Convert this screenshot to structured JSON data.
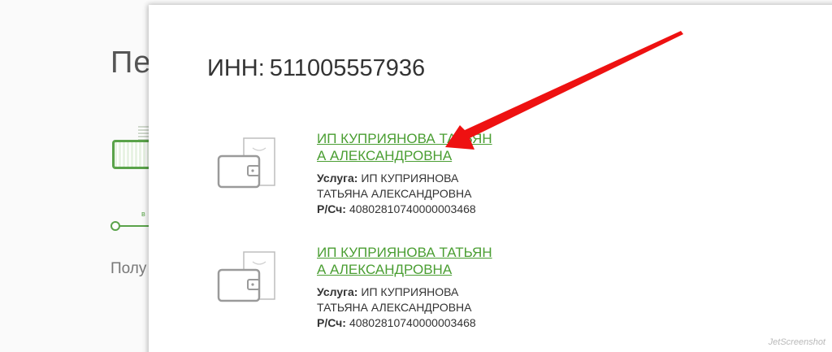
{
  "background": {
    "title": "Пе",
    "subtitle": "Полу",
    "slider_tick": "в"
  },
  "modal": {
    "inn_label": "ИНН:",
    "inn_value": "511005557936",
    "results": [
      {
        "name": "ИП КУПРИЯНОВА ТАТЬЯНА АЛЕКСАНДРОВНА",
        "service_label": "Услуга:",
        "service_value": "ИП КУПРИЯНОВА ТАТЬЯНА АЛЕКСАНДРОВНА",
        "account_label": "Р/Сч:",
        "account_value": "40802810740000003468"
      },
      {
        "name": "ИП КУПРИЯНОВА ТАТЬЯНА АЛЕКСАНДРОВНА",
        "service_label": "Услуга:",
        "service_value": "ИП КУПРИЯНОВА ТАТЬЯНА АЛЕКСАНДРОВНА",
        "account_label": "Р/Сч:",
        "account_value": "40802810740000003468"
      }
    ]
  },
  "watermark": "JetScreenshot",
  "colors": {
    "link": "#4a9e32",
    "arrow": "#ee1111",
    "text": "#333333"
  }
}
